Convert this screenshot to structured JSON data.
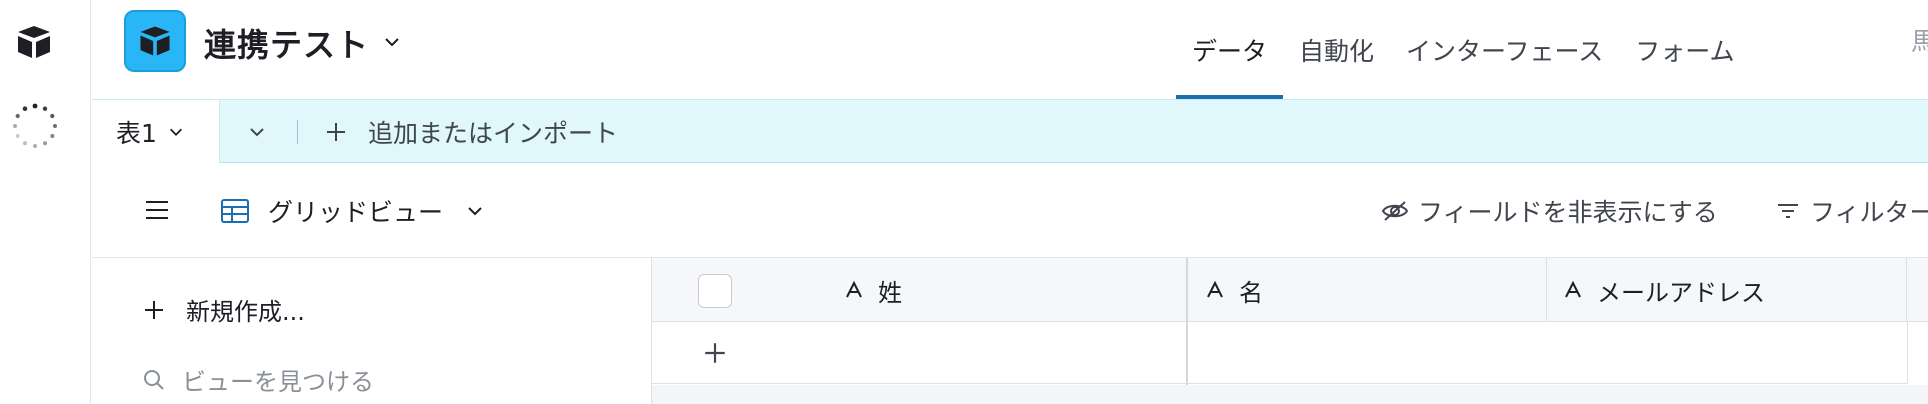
{
  "rail": {
    "logo_icon": "airtable-logo-icon",
    "spinner_icon": "loading-spinner-icon"
  },
  "header": {
    "base_name": "連携テスト",
    "base_icon": "cube-icon",
    "nav": [
      {
        "label": "データ",
        "active": true
      },
      {
        "label": "自動化",
        "active": false
      },
      {
        "label": "インターフェース",
        "active": false
      },
      {
        "label": "フォーム",
        "active": false
      }
    ],
    "nav_edge": "馬"
  },
  "tablebar": {
    "table_tab": "表1",
    "add_label": "追加またはインポート"
  },
  "viewbar": {
    "view_name": "グリッドビュー",
    "hide_fields": "フィールドを非表示にする",
    "filter": "フィルター"
  },
  "sidebar": {
    "new_view": "新規作成...",
    "find_view_placeholder": "ビューを見つける"
  },
  "grid": {
    "columns": [
      {
        "label": "姓",
        "type_icon": "text-field-icon"
      },
      {
        "label": "名",
        "type_icon": "text-field-icon"
      },
      {
        "label": "メールアドレス",
        "type_icon": "text-field-icon"
      }
    ]
  },
  "colors": {
    "accent": "#1a6fb0",
    "base_icon_bg": "#29b6f6",
    "tablebar_bg": "#e0f8fc"
  }
}
